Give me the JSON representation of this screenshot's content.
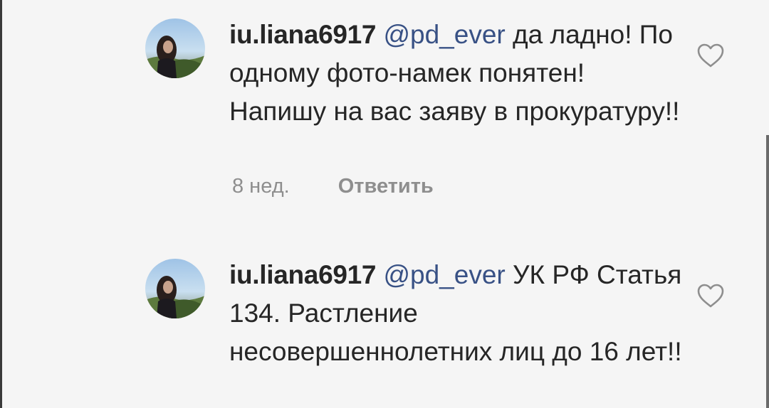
{
  "comments": [
    {
      "username": "iu.liana6917",
      "mention": "@pd_ever",
      "text": " да ладно! По одному фото-намек понятен! Напишу на вас заяву в прокуратуру!!",
      "timestamp": "8 нед.",
      "reply_label": "Ответить",
      "like_icon": "heart-outline-icon",
      "avatar_icon": "profile-photo"
    },
    {
      "username": "iu.liana6917",
      "mention": "@pd_ever",
      "text": " УК РФ Статья 134. Растление несовершеннолетних лиц до 16 лет!!",
      "like_icon": "heart-outline-icon",
      "avatar_icon": "profile-photo"
    }
  ],
  "colors": {
    "background": "#f5f5f5",
    "text": "#262626",
    "mention": "#385185",
    "secondary": "#8e8e8e"
  }
}
